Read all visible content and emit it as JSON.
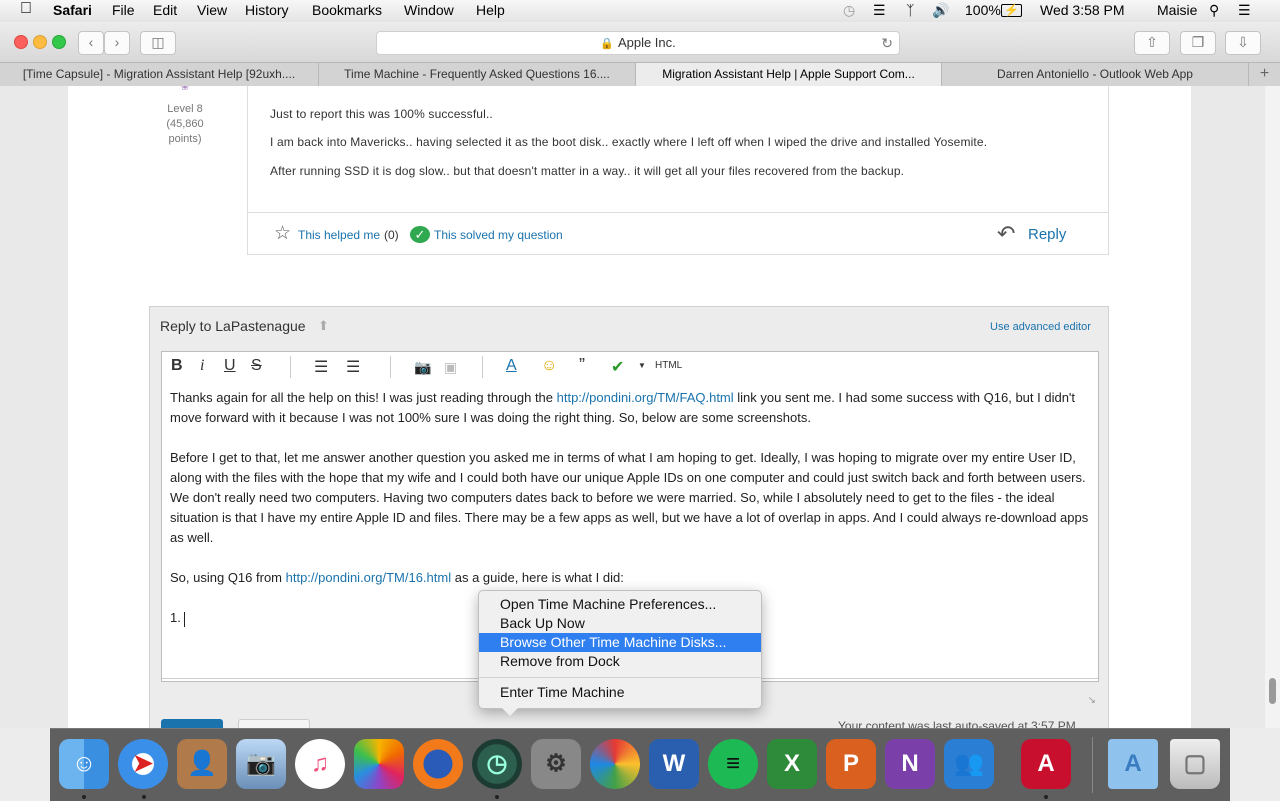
{
  "menubar": {
    "app": "Safari",
    "menus": [
      "File",
      "Edit",
      "View",
      "History",
      "Bookmarks",
      "Window",
      "Help"
    ],
    "battery": "100%",
    "clock": "Wed 3:58 PM",
    "user": "Maisie"
  },
  "toolbar": {
    "address": "Apple Inc."
  },
  "tabs": [
    "[Time Capsule] - Migration Assistant Help [92uxh....",
    "Time Machine - Frequently Asked Questions 16....",
    "Migration Assistant Help | Apple Support Com...",
    "Darren Antoniello - Outlook Web App"
  ],
  "post": {
    "level": "Level 8",
    "points_line1": "(45,860",
    "points_line2": "points)",
    "lines": [
      "Just to report this was 100% successful..",
      "I am back into Mavericks.. having selected it as the boot disk.. exactly where I left off when I wiped the drive and installed Yosemite.",
      "After running SSD it is dog slow.. but that doesn't matter in a way.. it will get all your files recovered from the backup."
    ],
    "helped": "This helped me",
    "helped_count": "(0)",
    "solved": "This solved my question",
    "reply": "Reply"
  },
  "reply_box": {
    "title": "Reply to LaPastenague",
    "advanced": "Use advanced editor",
    "html_btn": "HTML",
    "p1_a": "Thanks again for all the help on this! I was just reading through the ",
    "p1_link": "http://pondini.org/TM/FAQ.html",
    "p1_b": " link you sent me. I had some success with Q16, but I didn't",
    "p1_c": "move forward with it because I was not 100% sure I was doing the right thing. So, below are some screenshots.",
    "p2": [
      "Before I get to that, let me answer another question you asked me in terms of what I am hoping to get. Ideally, I was hoping to migrate over my entire User ID,",
      "along with the files with the hope that my wife and I could both have our unique Apple IDs on one computer and could just switch back and forth between users.",
      "We don't really need two computers. Having two computers dates back to before we were married. So, while I absolutely need to get to the files - the ideal",
      "situation is that I have my entire Apple ID and files. There may be a few apps as well, but we have a lot of overlap in apps. And I could always re-download apps",
      "as well."
    ],
    "p3_a": "So, using Q16 from ",
    "p3_link": "http://pondini.org/TM/16.html",
    "p3_b": " as a guide, here is what I did:",
    "p4": "1.",
    "autosave": "Your content was last auto-saved at 3:57 PM"
  },
  "context_menu": {
    "items": [
      "Open Time Machine Preferences...",
      "Back Up Now",
      "Browse Other Time Machine Disks...",
      "Remove from Dock",
      "Enter Time Machine"
    ],
    "selected": "Browse Other Time Machine Disks..."
  },
  "dock": {
    "icons": [
      "finder-icon",
      "safari-icon",
      "contacts-icon",
      "preview-icon",
      "itunes-icon",
      "photos-icon",
      "firefox-icon",
      "time-machine-icon",
      "system-preferences-icon",
      "picasa-icon",
      "word-icon",
      "spotify-icon",
      "excel-icon",
      "powerpoint-icon",
      "onenote-icon",
      "lync-icon",
      "acrobat-icon",
      "applications-folder-icon",
      "trash-icon"
    ]
  }
}
